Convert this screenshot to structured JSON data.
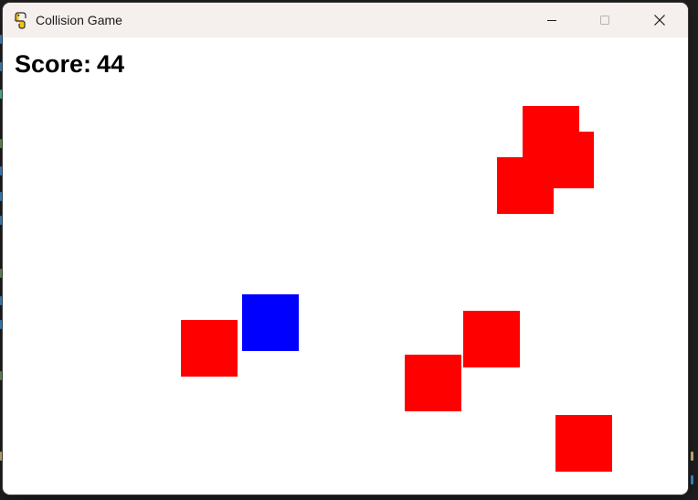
{
  "window": {
    "title": "Collision Game",
    "app_icon": "python-snake-icon",
    "controls": [
      "minimize-icon",
      "maximize-icon",
      "close-icon"
    ]
  },
  "game": {
    "score_label": "Score:",
    "score_value": "44",
    "background_color": "#ffffff",
    "player_color": "#0000ff",
    "enemy_color": "#ff0000",
    "player_count": 1,
    "enemy_count": 7
  }
}
